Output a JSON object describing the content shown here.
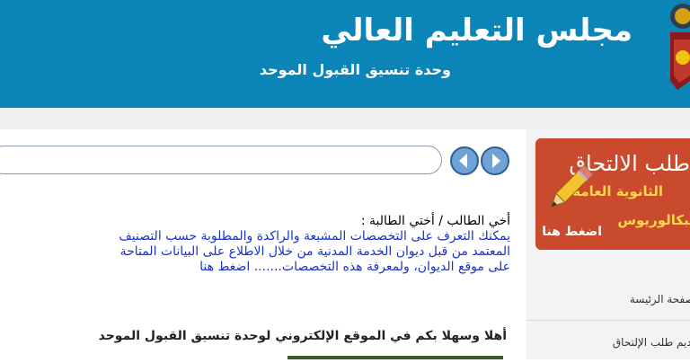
{
  "header": {
    "title": "مجلس التعليم العالي",
    "subtitle": "وحدة تنسيق القبول الموحد",
    "bg_color": "#0b84b8"
  },
  "search": {
    "value": "",
    "prev_icon": "arrow-left-circle",
    "next_icon": "arrow-right-circle"
  },
  "notice": {
    "greeting": "أخي الطالب / أختي الطالبة :",
    "lines": [
      "يمكنك التعرف على التخصصات المشبعة والراكدة والمطلوبة حسب التصنيف",
      "المعتمد من قبل ديوان الخدمة المدنية من خلال الاطلاع على البيانات المتاحة",
      "على موقع الديوان، ولمعرفة هذه التخصصات....... اضغط هنا"
    ],
    "link_color": "#1a33c8"
  },
  "welcome": "أهلا وسهلا بكم في الموقع الإلكتروني لوحدة تنسيق القبول الموحد",
  "sidebar": {
    "banner": {
      "title": "طلب الالتحاق",
      "line1": "الثانوية العامة",
      "line2": "البكالوريوس",
      "click": "اضغط هنا",
      "bg_color": "#c94a2c",
      "highlight_color": "#ffd84a"
    },
    "items": [
      {
        "label": "الصفحة الرئيسة"
      },
      {
        "label": "تقديم طلب الإلتحاق"
      }
    ]
  }
}
